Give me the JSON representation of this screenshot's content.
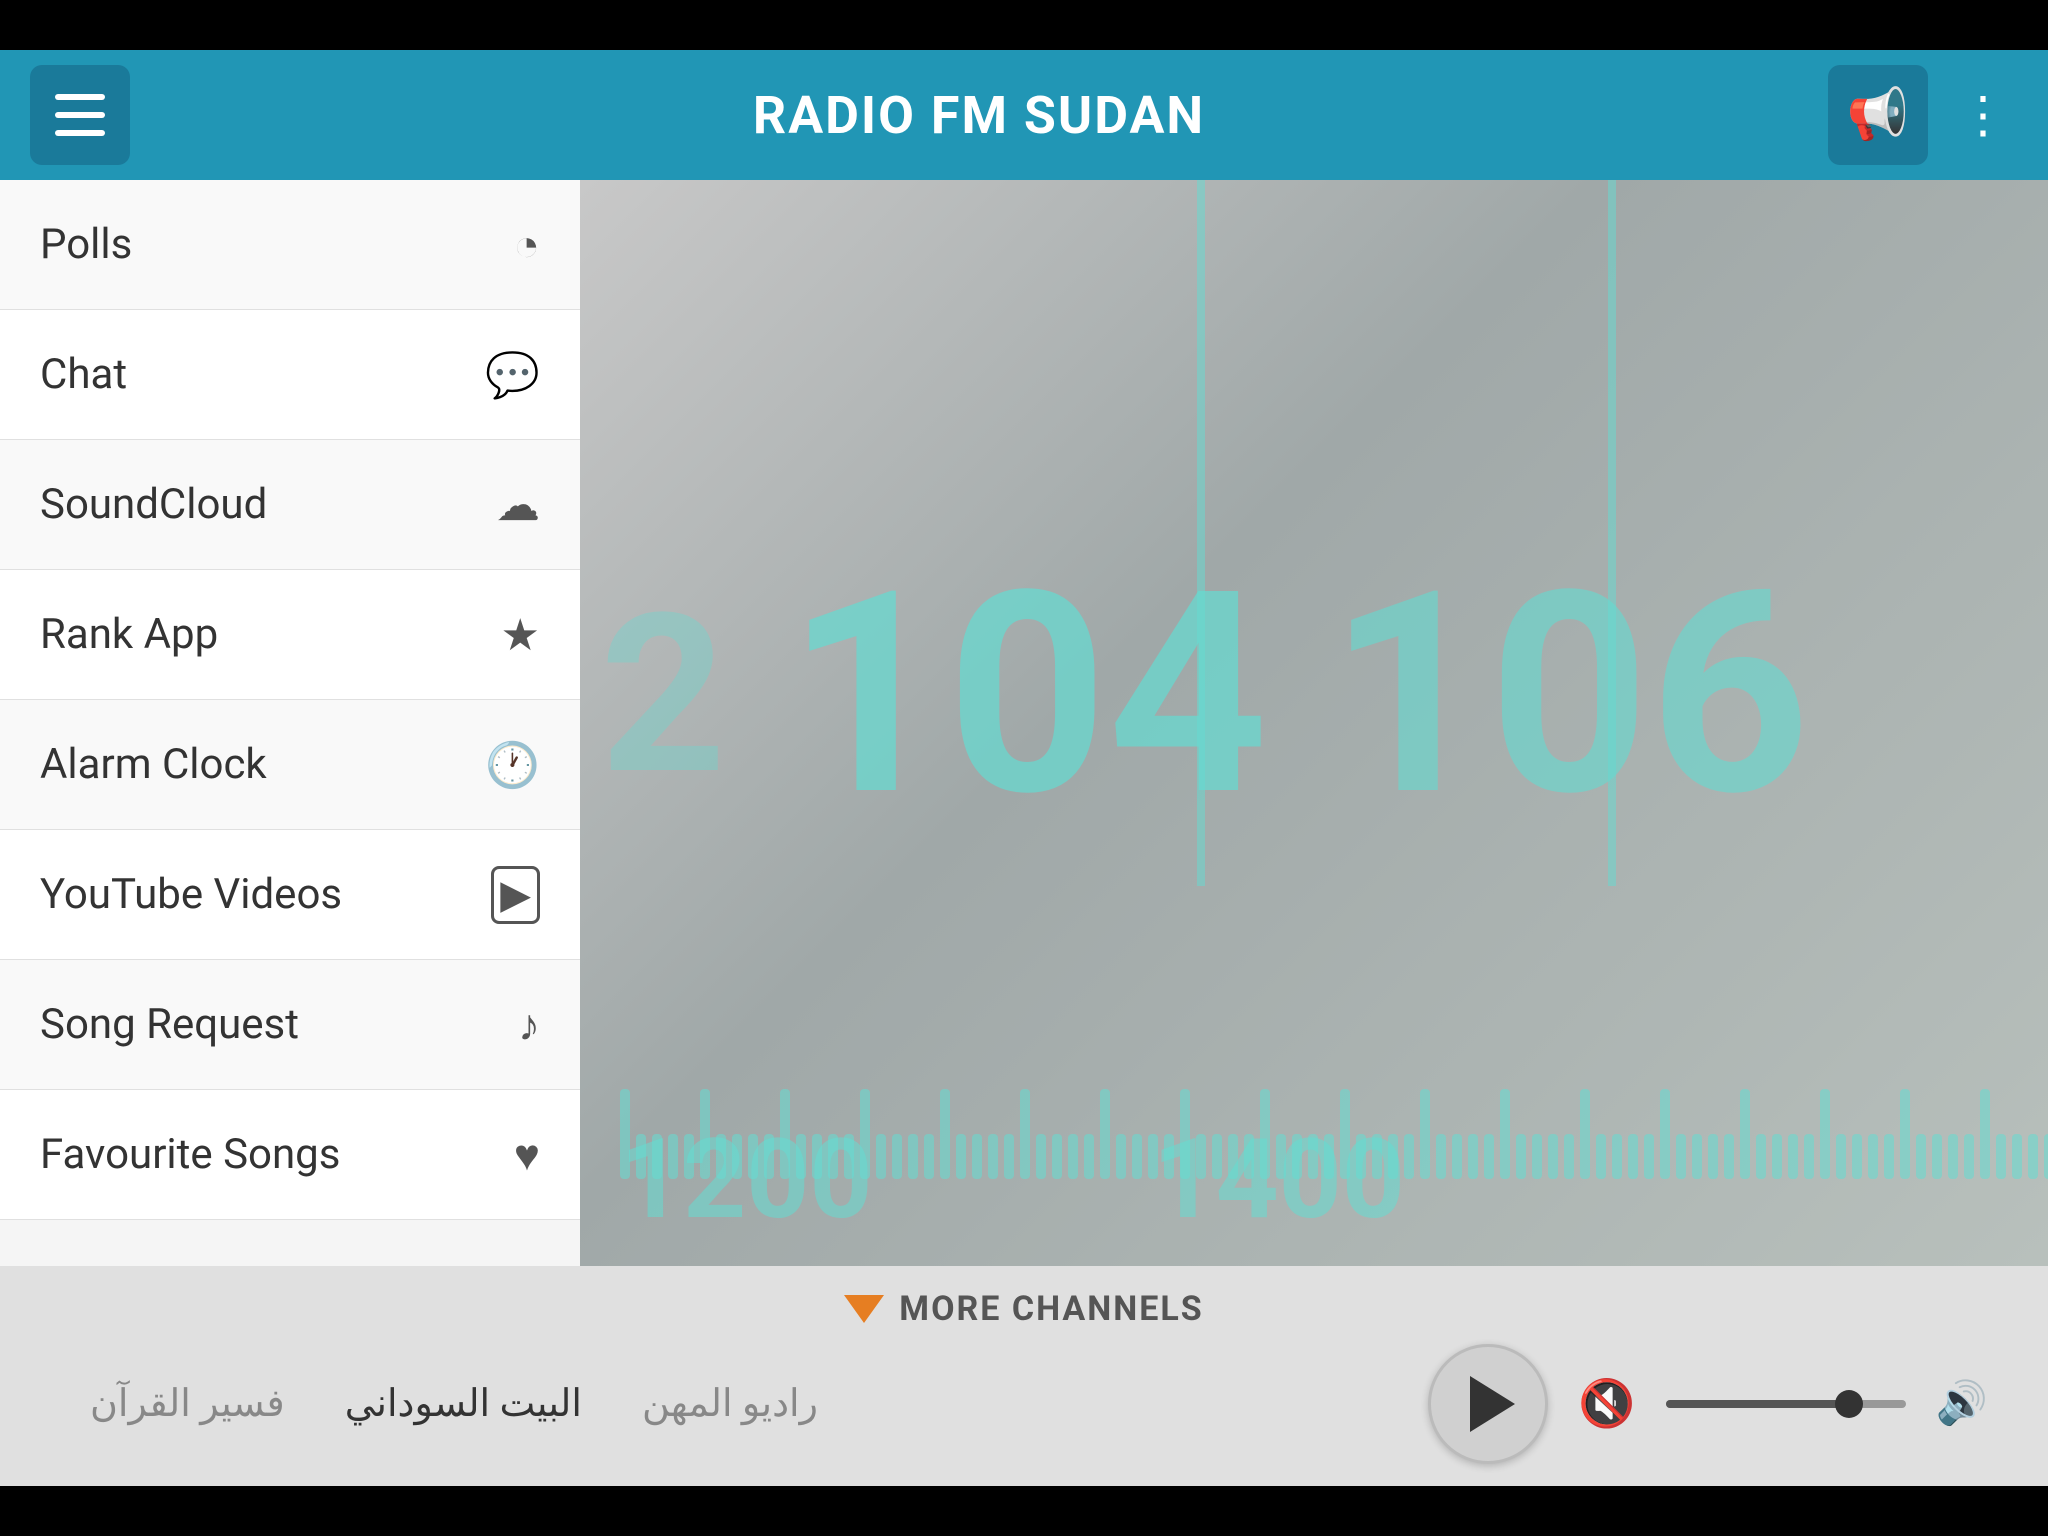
{
  "header": {
    "title": "RADIO FM SUDAN",
    "menu_label": "Menu",
    "speaker_label": "Speaker",
    "more_label": "More options"
  },
  "sidebar": {
    "items": [
      {
        "id": "polls",
        "label": "Polls",
        "icon": "pie-chart"
      },
      {
        "id": "chat",
        "label": "Chat",
        "icon": "chat"
      },
      {
        "id": "soundcloud",
        "label": "SoundCloud",
        "icon": "cloud"
      },
      {
        "id": "rank-app",
        "label": "Rank App",
        "icon": "star"
      },
      {
        "id": "alarm-clock",
        "label": "Alarm Clock",
        "icon": "clock"
      },
      {
        "id": "youtube-videos",
        "label": "YouTube Videos",
        "icon": "youtube"
      },
      {
        "id": "song-request",
        "label": "Song Request",
        "icon": "music-note"
      },
      {
        "id": "favourite-songs",
        "label": "Favourite Songs",
        "icon": "heart"
      }
    ]
  },
  "radio_dial": {
    "numbers": [
      "2",
      "104",
      "106"
    ],
    "sub_numbers": [
      "1200",
      "1400"
    ]
  },
  "bottom": {
    "more_channels_label": "MORE CHANNELS",
    "channels": [
      {
        "name": "فسير القرآن",
        "active": false
      },
      {
        "name": "البيت السوداني",
        "active": true
      },
      {
        "name": "راديو المهن",
        "active": false
      }
    ]
  },
  "icons": {
    "pie_chart": "◔",
    "chat": "💬",
    "cloud": "☁",
    "star": "★",
    "clock": "🕐",
    "youtube": "▶",
    "music_note": "♪",
    "heart": "♥",
    "hamburger": "≡",
    "speaker": "📢",
    "more": "⋮",
    "play": "▶",
    "mute": "🔇",
    "volume": "🔊"
  }
}
